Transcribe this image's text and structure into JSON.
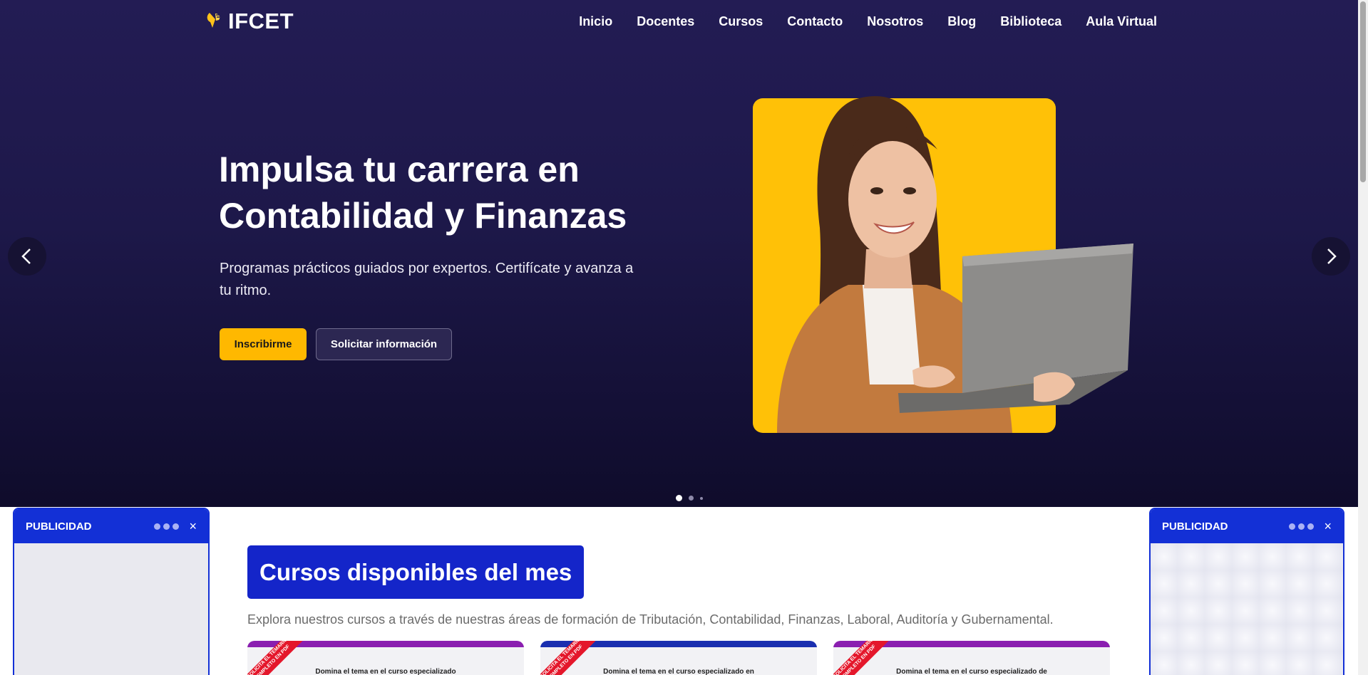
{
  "nav": {
    "logo_text": "IFCET",
    "items": [
      {
        "label": "Inicio"
      },
      {
        "label": "Docentes"
      },
      {
        "label": "Cursos"
      },
      {
        "label": "Contacto"
      },
      {
        "label": "Nosotros"
      },
      {
        "label": "Blog"
      },
      {
        "label": "Biblioteca"
      },
      {
        "label": "Aula Virtual"
      }
    ]
  },
  "hero": {
    "title": "Impulsa tu carrera en Contabilidad y Finanzas",
    "subtitle": "Programas prácticos guiados por expertos. Certifícate y avanza a tu ritmo.",
    "primary_button": "Inscribirme",
    "secondary_button": "Solicitar información",
    "slides_total": 3,
    "active_slide": 1,
    "prev_icon": "chevron-left-icon",
    "next_icon": "chevron-right-icon"
  },
  "courses": {
    "title": "Cursos disponibles del mes",
    "description": "Explora nuestros cursos a través de nuestras áreas de formación de Tributación, Contabilidad, Finanzas, Laboral, Auditoría y Gubernamental.",
    "cards": [
      {
        "ribbon": "SOLICITA EL TEMARIO COMPLETO EN PDF",
        "text": "Domina el tema en el curso especializado",
        "bar_color": "#8a1fb0"
      },
      {
        "ribbon": "SOLICITA EL TEMARIO COMPLETO EN PDF",
        "text": "Domina el tema en el curso especializado en",
        "bar_color": "#1a2fb0"
      },
      {
        "ribbon": "SOLICITA EL TEMARIO COMPLETO EN PDF",
        "text": "Domina el tema en el curso especializado de",
        "bar_color": "#8a1fb0"
      }
    ]
  },
  "ads": {
    "left": {
      "title": "PUBLICIDAD",
      "close": "×"
    },
    "right": {
      "title": "PUBLICIDAD",
      "close": "×"
    }
  },
  "colors": {
    "hero_bg": "#1d1849",
    "accent_yellow": "#ffb800",
    "brand_blue": "#1425c9",
    "ad_blue": "#1330d6"
  }
}
